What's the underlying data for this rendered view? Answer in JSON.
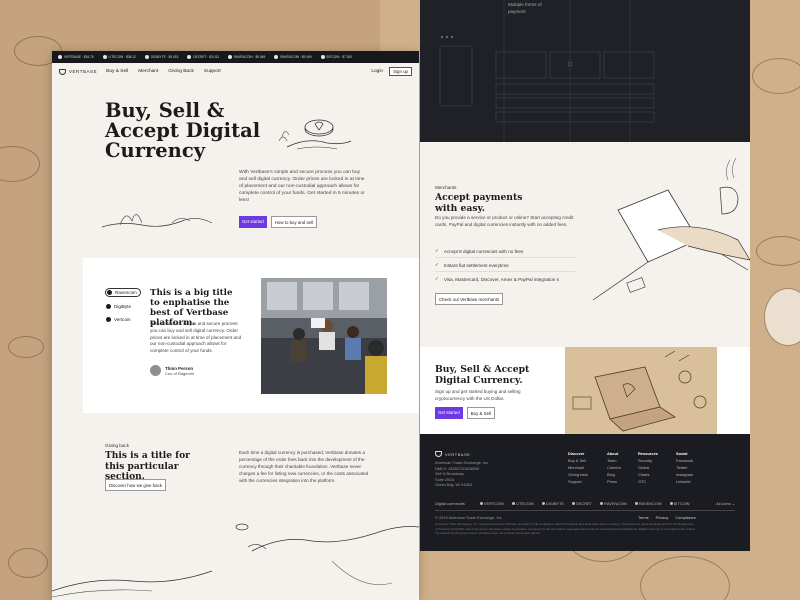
{
  "left": {
    "ticker": [
      {
        "label": "VERTBASE · $36.75"
      },
      {
        "label": "LITECOIN · $38.12"
      },
      {
        "label": "DIGIBYTE · $9.015"
      },
      {
        "label": "DECRET · $3.013"
      },
      {
        "label": "RAVENCOIN · $9.069"
      },
      {
        "label": "RAVENCOIN · $9.069"
      },
      {
        "label": "BITCOIN · $7.300"
      }
    ],
    "nav": {
      "logo": "VERTBASE",
      "links": [
        "Buy & Sell",
        "Merchant",
        "Giving Back",
        "Support"
      ],
      "login": "Login",
      "signup": "Sign up"
    },
    "hero": {
      "title": "Buy, Sell & Accept Digital Currency",
      "text": "With Vertbase's simple and secure process you can buy and sell digital currency. Order prices are locked in at time of placement and our non-custodial approach allows for complete control of your funds. Get started in 5 minutes or less!",
      "primary": "Get started",
      "secondary": "How to buy and sell"
    },
    "feature_card": {
      "cryptos": [
        "Ravencoin",
        "DigiByte",
        "Vertcoin"
      ],
      "title": "This is a big title to enphatise the best of Vertbase platform.",
      "text": "With Vertbase's simple and secure process you can buy and sell digital currency. Order prices are locked in at time of placement and our non-custodial approach allows for complete control of your funds.",
      "person_name": "Thinn Person",
      "person_role": "Ceo of Rageroin"
    },
    "giving": {
      "label": "Giving back",
      "title": "This is a title for this particular section.",
      "button": "Discover how we give back",
      "text": "Each time a digital currency is purchased, Vertbase donates a percentage of the order fees back into the development of the currency through their charitable foundation. Vertbase never charges a fee for listing new currencies, or the costs associated with the currencies integration into the platform."
    }
  },
  "right": {
    "tooltip": [
      "Multiple forms of",
      "payment"
    ],
    "merchants": {
      "label": "Merchants",
      "title": "Accept payments with easy.",
      "text": "Do you provide a service or product or online? Start accepting credit cards, PayPal and digital currencies instantly with no added fees.",
      "features": [
        "Accept 8 digital currencies with no fees",
        "Instant fiat settlement everytime",
        "Visa, Mastercard, Discover, Amex & PayPal integration s"
      ],
      "button": "Check out Vertbase merchants"
    },
    "cta": {
      "title": "Buy, Sell & Accept Digital Currency.",
      "text": "Sign up and get started buying and selling cryptocurrency with the US Dollar.",
      "primary": "Get started",
      "secondary": "Buy & Sell"
    },
    "footer": {
      "logo": "VERTBASE",
      "address": [
        "American Trade Exchange, Inc",
        "NMLS: 1538272/1838030",
        "348 N Broadway",
        "Suite 200A",
        "Green Bay, WI 54303"
      ],
      "columns": [
        {
          "title": "Discover",
          "links": [
            "Buy & Sell",
            "Merchant",
            "Giving back",
            "Support"
          ]
        },
        {
          "title": "About",
          "links": [
            "Team",
            "Careers",
            "Blog",
            "Press"
          ]
        },
        {
          "title": "Resources",
          "links": [
            "Security",
            "Global",
            "Charts",
            "OTC"
          ]
        },
        {
          "title": "Social",
          "links": [
            "Facebook",
            "Twitter",
            "Instagram",
            "LinkedIn"
          ]
        }
      ],
      "tickers_label": "Digital currencies",
      "tickers": [
        "VERTCOIN",
        "LITECOIN",
        "DIGIBYTE",
        "DECRET",
        "RAVENCOIN",
        "RAVENCOIN",
        "BITCOIN"
      ],
      "all_coins": "All coins ⌄",
      "copyright": "© 2019 American Trade Exchange, Inc",
      "legal": [
        "Terms",
        "Privacy",
        "Compliance"
      ],
      "disclaimer": "American Trade Exchange, Inc. doing business as Vertbase operates in full compliance with both federal and state laws and is a Money Transmitter in good standing with the US Department of Treasury (FinCEN) and is licensed in all states where it operates. Customer funds are held in segregated accounts at insured financial institutions. Digital currency is not legal tender and is not backed by the government. Vertbase does not provide investment advice."
    }
  }
}
